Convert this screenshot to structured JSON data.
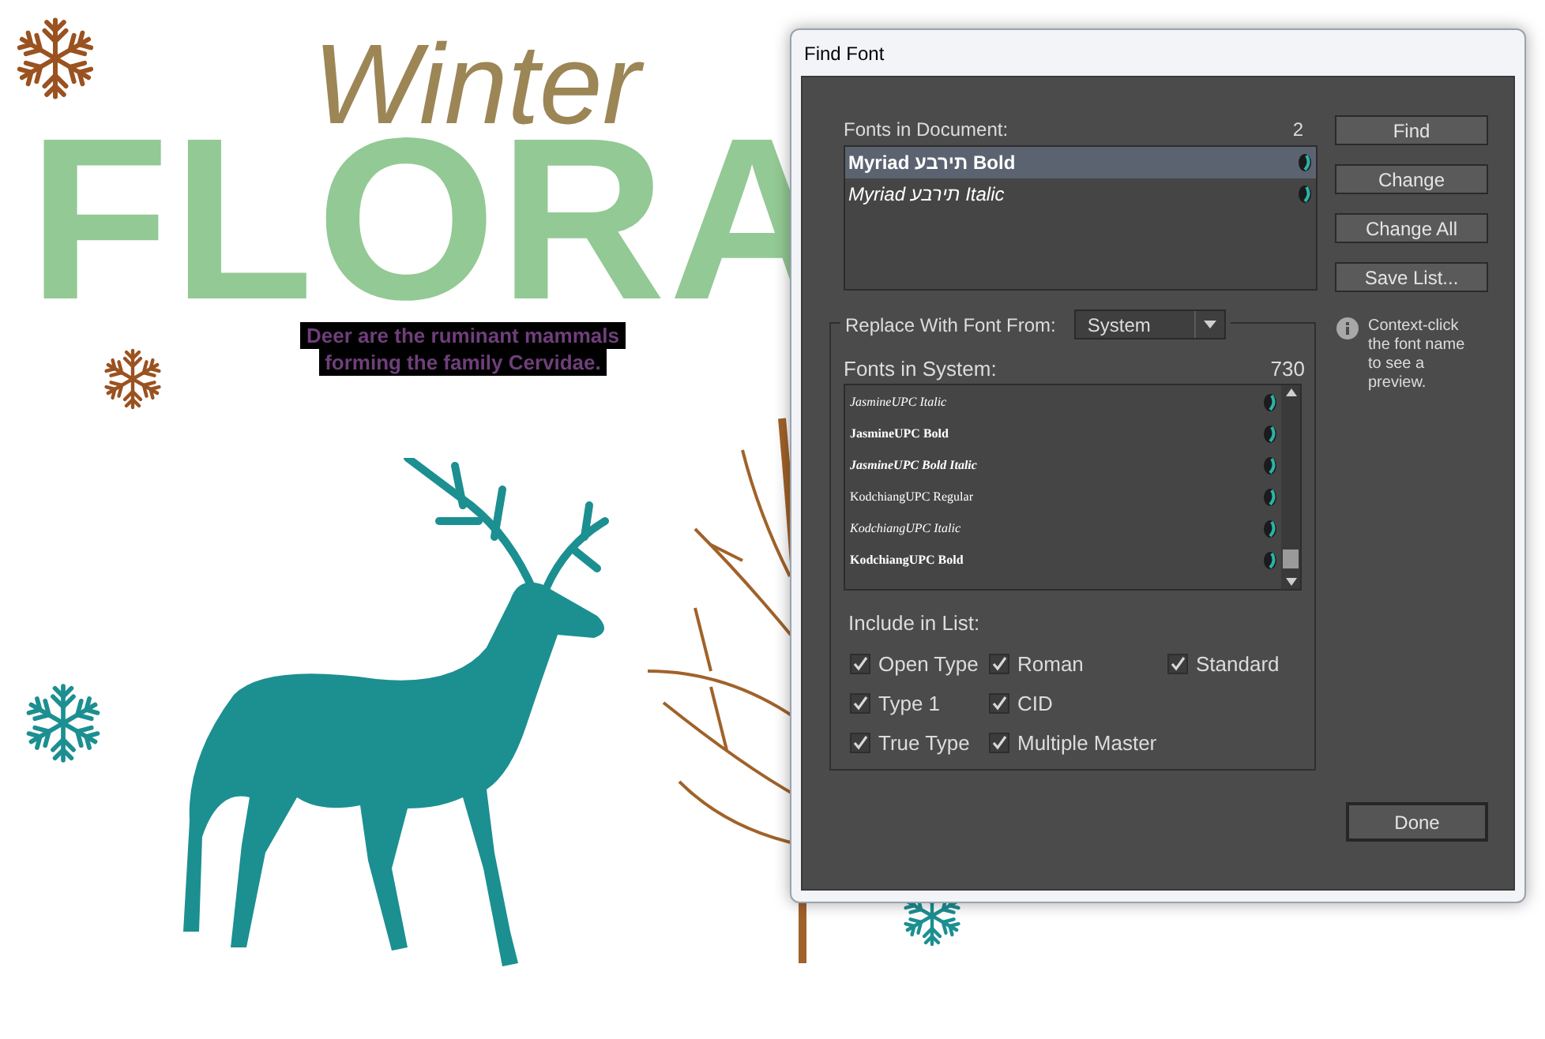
{
  "poster": {
    "title_small": "Winter",
    "title_big": "FLORA",
    "caption_lines": [
      "Deer are the ruminant mammals",
      "forming the family Cervidae."
    ]
  },
  "dialog": {
    "title": "Find Font",
    "fonts_in_document": {
      "label": "Fonts in Document:",
      "count": "2",
      "items": [
        {
          "name": "Myriad תירבע Bold",
          "kind": "bold",
          "selected": true
        },
        {
          "name": "Myriad תירבע Italic",
          "kind": "italic",
          "selected": false
        }
      ]
    },
    "buttons": [
      "Find",
      "Change",
      "Change All",
      "Save List..."
    ],
    "info_text": "Context-click the font name to see a preview.",
    "replace_group": {
      "label": "Replace With Font From:",
      "dropdown": {
        "value": "System"
      },
      "fonts_in_system": {
        "label": "Fonts in System:",
        "count": "730",
        "items": [
          {
            "name": "JasmineUPC Italic",
            "kind": "italic"
          },
          {
            "name": "JasmineUPC Bold",
            "kind": "bold"
          },
          {
            "name": "JasmineUPC Bold Italic",
            "kind": "bolditalic"
          },
          {
            "name": "KodchiangUPC Regular",
            "kind": "regular"
          },
          {
            "name": "KodchiangUPC Italic",
            "kind": "italic"
          },
          {
            "name": "KodchiangUPC Bold",
            "kind": "bold"
          }
        ]
      },
      "include_label": "Include in List:",
      "include_options": [
        {
          "label": "Open Type",
          "checked": true
        },
        {
          "label": "Roman",
          "checked": true
        },
        {
          "label": "Standard",
          "checked": true
        },
        {
          "label": "Type 1",
          "checked": true
        },
        {
          "label": "CID",
          "checked": true
        },
        {
          "label": "True Type",
          "checked": true
        },
        {
          "label": "Multiple Master",
          "checked": true
        }
      ]
    },
    "done_button": "Done"
  }
}
